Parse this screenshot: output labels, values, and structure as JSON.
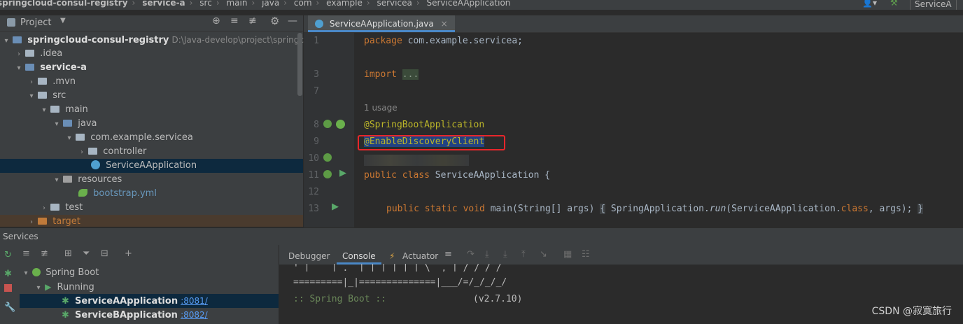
{
  "breadcrumb": [
    "springcloud-consul-registry",
    "service-a",
    "src",
    "main",
    "java",
    "com",
    "example",
    "servicea",
    "ServiceAApplication"
  ],
  "topbar_right_label": "ServiceA",
  "project_panel": {
    "title": "Project",
    "root_label": "springcloud-consul-registry",
    "root_path": "D:\\Java-develop\\project\\springcloud-",
    "items": [
      {
        "label": ".idea"
      },
      {
        "label": "service-a"
      },
      {
        "label": ".mvn"
      },
      {
        "label": "src"
      },
      {
        "label": "main"
      },
      {
        "label": "java"
      },
      {
        "label": "com.example.servicea"
      },
      {
        "label": "controller"
      },
      {
        "label": "ServiceAApplication"
      },
      {
        "label": "resources"
      },
      {
        "label": "bootstrap.yml"
      },
      {
        "label": "test"
      },
      {
        "label": "target"
      }
    ]
  },
  "editor": {
    "tab_label": "ServiceAApplication.java",
    "line_numbers": [
      "1",
      "3",
      "7",
      "8",
      "9",
      "10",
      "11",
      "12",
      "13"
    ],
    "code": {
      "package_kw": "package",
      "package_name": " com.example.servicea;",
      "import_kw": "import",
      "import_fold": "...",
      "usage": "1 usage",
      "annotation1": "@SpringBootApplication",
      "annotation2": "@EnableDiscoveryClient",
      "class_kw": "public class",
      "class_name": " ServiceAApplication {",
      "main_kw": "public static void",
      "main_sig": " main(String[] args) ",
      "brace_open": "{",
      "main_body_1": " SpringApplication.",
      "main_body_run": "run",
      "main_body_2": "(ServiceAApplication.",
      "main_body_class_kw": "class",
      "main_body_3": ", args);",
      "brace_close": "}"
    }
  },
  "services": {
    "title": "Services",
    "tabs": [
      "Debugger",
      "Console",
      "Actuator"
    ],
    "active_tab": "Console",
    "tree": {
      "group": "Spring Boot",
      "state": "Running",
      "apps": [
        {
          "name": "ServiceAApplication",
          "port": ":8081/"
        },
        {
          "name": "ServiceBApplication",
          "port": ":8082/"
        }
      ]
    },
    "console_lines": [
      " '  |____| .__|_| |_|_| |_\\__, | / / / /",
      "=========|_|==============|___/=/_/_/_/",
      " :: Spring Boot ::",
      "(v2.7.10)"
    ]
  },
  "watermark": "CSDN @寂寞旅行"
}
